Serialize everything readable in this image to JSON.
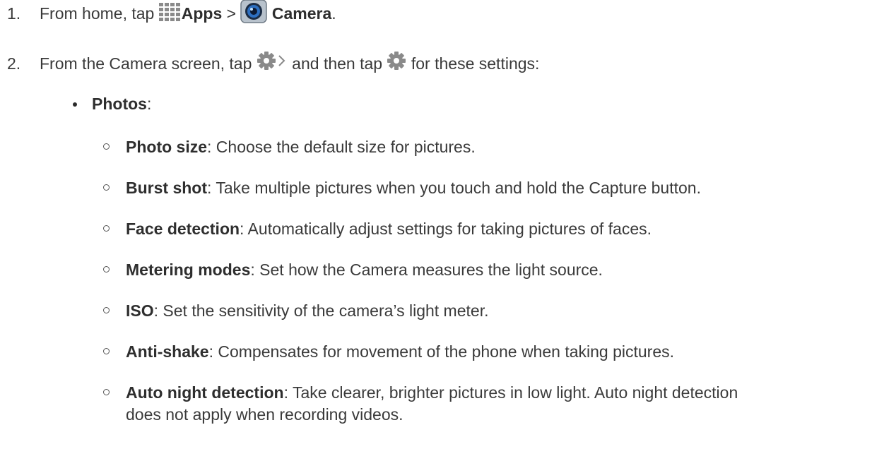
{
  "steps": [
    {
      "number": "1.",
      "prefix": "From home, tap ",
      "apps_label": "Apps",
      "separator": " > ",
      "camera_label": "Camera",
      "suffix": "."
    },
    {
      "number": "2.",
      "prefix": "From the Camera screen, tap ",
      "middle": " and then tap ",
      "suffix": " for these settings:"
    }
  ],
  "bullet": {
    "label": "Photos",
    "suffix": ":"
  },
  "settings": [
    {
      "name": "Photo size",
      "desc": ": Choose the default size for pictures."
    },
    {
      "name": "Burst shot",
      "desc": ": Take multiple pictures when you touch and hold the Capture button."
    },
    {
      "name": "Face detection",
      "desc": ": Automatically adjust settings for taking pictures of faces."
    },
    {
      "name": "Metering modes",
      "desc": ": Set how the Camera measures the light source."
    },
    {
      "name": "ISO",
      "desc": ": Set the sensitivity of the camera’s light meter."
    },
    {
      "name": "Anti-shake",
      "desc": ": Compensates for movement of the phone when taking pictures."
    },
    {
      "name": "Auto night detection",
      "desc": ": Take clearer, brighter pictures in low light. Auto night detection",
      "desc_line2": "does not apply when recording videos."
    }
  ],
  "icons": {
    "apps": "apps-grid-icon",
    "camera": "camera-app-icon",
    "settings_arrow": "gear-chevron-icon",
    "settings": "gear-icon"
  },
  "colors": {
    "text": "#3a3a3a",
    "icon_gray": "#8a8a8a",
    "camera_blue": "#3b8fd8"
  }
}
